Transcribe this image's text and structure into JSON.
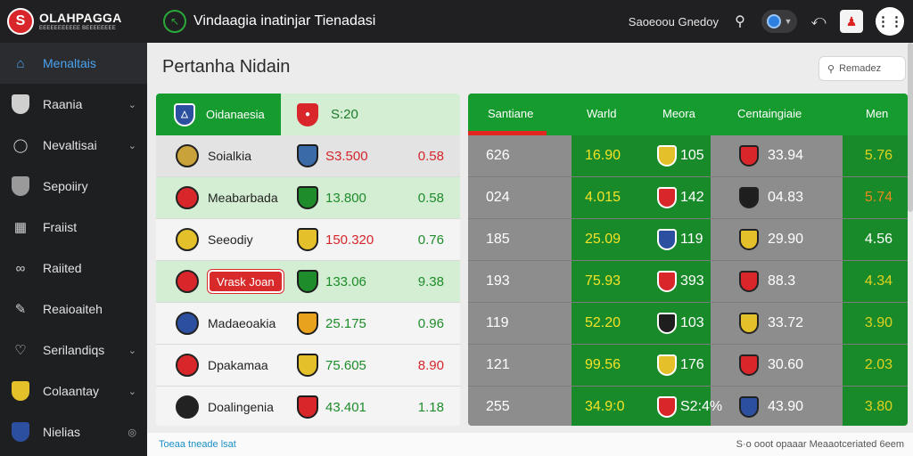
{
  "logo": {
    "title": "OLAHPAGGA",
    "subtitle": "EEEEEEEEEEE BEEEEEEEE"
  },
  "header": {
    "app_title": "Vindaagia inatinjar Tienadasi",
    "user_name": "Saoeoou Gnedoy"
  },
  "sidebar": {
    "items": [
      {
        "label": "Menaltais",
        "icon": "home-icon",
        "chevron": false,
        "active": true
      },
      {
        "label": "Raania",
        "icon": "shield-icon",
        "chevron": true
      },
      {
        "label": "Nevaltisai",
        "icon": "runner-icon",
        "chevron": true
      },
      {
        "label": "Sepoiiry",
        "icon": "shield-icon",
        "chevron": false
      },
      {
        "label": "Fraiist",
        "icon": "grid-icon",
        "chevron": false
      },
      {
        "label": "Raiited",
        "icon": "link-icon",
        "chevron": false
      },
      {
        "label": "Reaioaiteh",
        "icon": "pencil-icon",
        "chevron": false
      },
      {
        "label": "Serilandiqs",
        "icon": "heart-icon",
        "chevron": true
      },
      {
        "label": "Colaantay",
        "icon": "badge-icon",
        "chevron": true
      },
      {
        "label": "Nielias",
        "icon": "flag-icon",
        "chevron": false,
        "radio": true
      }
    ]
  },
  "main": {
    "page_title": "Pertanha Nidain",
    "search_placeholder": "Remadez"
  },
  "left_table": {
    "header": {
      "team": "Oidanaesia",
      "value": "S:20"
    },
    "rows": [
      {
        "name": "Soialkia",
        "value": "S3.500",
        "value_color": "#d4262b",
        "num": "0.58",
        "num_color": "#d4262b",
        "c1": "#caa23a",
        "c2": "#3a6aa8",
        "bg": "#e3e3e3"
      },
      {
        "name": "Meabarbada",
        "value": "13.800",
        "value_color": "#1e8c2a",
        "num": "0.58",
        "num_color": "#1e8c2a",
        "c1": "#d8262b",
        "c2": "#1e8c2a",
        "bg": "#d4eed4"
      },
      {
        "name": "Seeodiy",
        "value": "150.320",
        "value_color": "#d4262b",
        "num": "0.76",
        "num_color": "#1e8c2a",
        "c1": "#e4c12a",
        "c2": "#e4c12a",
        "bg": "#f4f4f4"
      },
      {
        "name": "Vrask Joan",
        "value": "133.06",
        "value_color": "#1e8c2a",
        "num": "9.38",
        "num_color": "#1e8c2a",
        "c1": "#d8262b",
        "c2": "#1e8c2a",
        "bg": "#d4eed4",
        "pill": true
      },
      {
        "name": "Madaeoakia",
        "value": "25.175",
        "value_color": "#1e8c2a",
        "num": "0.96",
        "num_color": "#1e8c2a",
        "c1": "#2d4fa0",
        "c2": "#e8a21e",
        "bg": "#f4f4f4"
      },
      {
        "name": "Dpakamaa",
        "value": "75.605",
        "value_color": "#1e8c2a",
        "num": "8.90",
        "num_color": "#d4262b",
        "c1": "#d8262b",
        "c2": "#e4c12a",
        "bg": "#f4f4f4"
      },
      {
        "name": "Doalingenia",
        "value": "43.401",
        "value_color": "#1e8c2a",
        "num": "1.18",
        "num_color": "#1e8c2a",
        "c1": "#222222",
        "c2": "#d8262b",
        "bg": "#f4f4f4"
      }
    ]
  },
  "right_table": {
    "headers": [
      "Santiane",
      "Warld",
      "Meora",
      "Centaingiaie",
      "Men"
    ],
    "rows": [
      {
        "c1": "626",
        "g1v": "16.90",
        "g1n": "105",
        "mid": "33.94",
        "g2": "5.76",
        "g2_color": "#e0d21f"
      },
      {
        "c1": "024",
        "g1v": "4.015",
        "g1n": "142",
        "mid": "04.83",
        "g2": "5.74",
        "g2_color": "#e8891e"
      },
      {
        "c1": "185",
        "g1v": "25.09",
        "g1n": "119",
        "mid": "29.90",
        "g2": "4.56",
        "g2_color": "#ffffff"
      },
      {
        "c1": "193",
        "g1v": "75.93",
        "g1n": "393",
        "mid": "88.3",
        "g2": "4.34",
        "g2_color": "#e0d21f"
      },
      {
        "c1": "119",
        "g1v": "52.20",
        "g1n": "103",
        "mid": "33.72",
        "g2": "3.90",
        "g2_color": "#e0d21f"
      },
      {
        "c1": "121",
        "g1v": "99.56",
        "g1n": "176",
        "mid": "30.60",
        "g2": "2.03",
        "g2_color": "#e0d21f"
      },
      {
        "c1": "255",
        "g1v": "34.9:0",
        "g1n": "S2:4%",
        "mid": "43.90",
        "g2": "3.80",
        "g2_color": "#e0d21f"
      }
    ]
  },
  "footer": {
    "left": "Toeaa tneade lsat",
    "right": "S·o  ooot opaaar  Meaaotceriated 6eem"
  }
}
